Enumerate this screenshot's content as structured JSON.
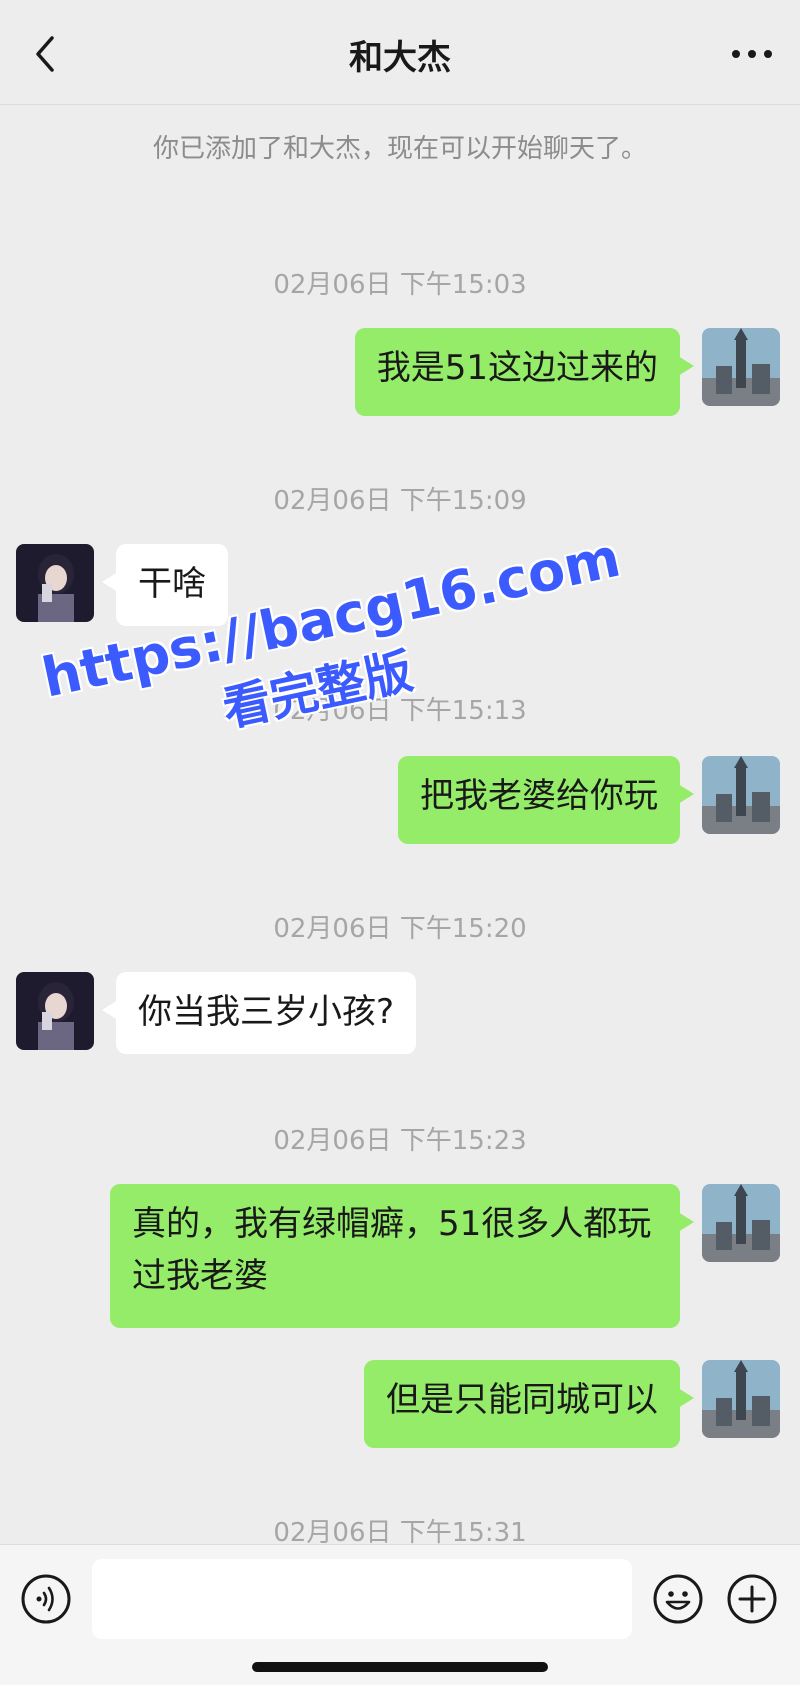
{
  "header": {
    "title": "和大杰"
  },
  "system_message": "你已添加了和大杰，现在可以开始聊天了。",
  "messages": [
    {
      "timestamp": "02月06日 下午15:03",
      "text": "我是51这边过来的"
    },
    {
      "timestamp": "02月06日 下午15:09",
      "text": "干啥"
    },
    {
      "timestamp": "02月06日 下午15:13",
      "text": "把我老婆给你玩"
    },
    {
      "timestamp": "02月06日 下午15:20",
      "text": "你当我三岁小孩?"
    },
    {
      "timestamp": "02月06日 下午15:23",
      "text": "真的，我有绿帽癖，51很多人都玩过我老婆"
    },
    {
      "text": "但是只能同城可以"
    },
    {
      "timestamp": "02月06日 下午15:31"
    }
  ],
  "watermark": {
    "url": "https://bacg16.com",
    "subtitle": "看完整版"
  },
  "input": {
    "value": ""
  },
  "colors": {
    "my_bubble": "#95ec69",
    "their_bubble": "#ffffff",
    "background": "#ededed",
    "watermark": "#3b5bff"
  }
}
